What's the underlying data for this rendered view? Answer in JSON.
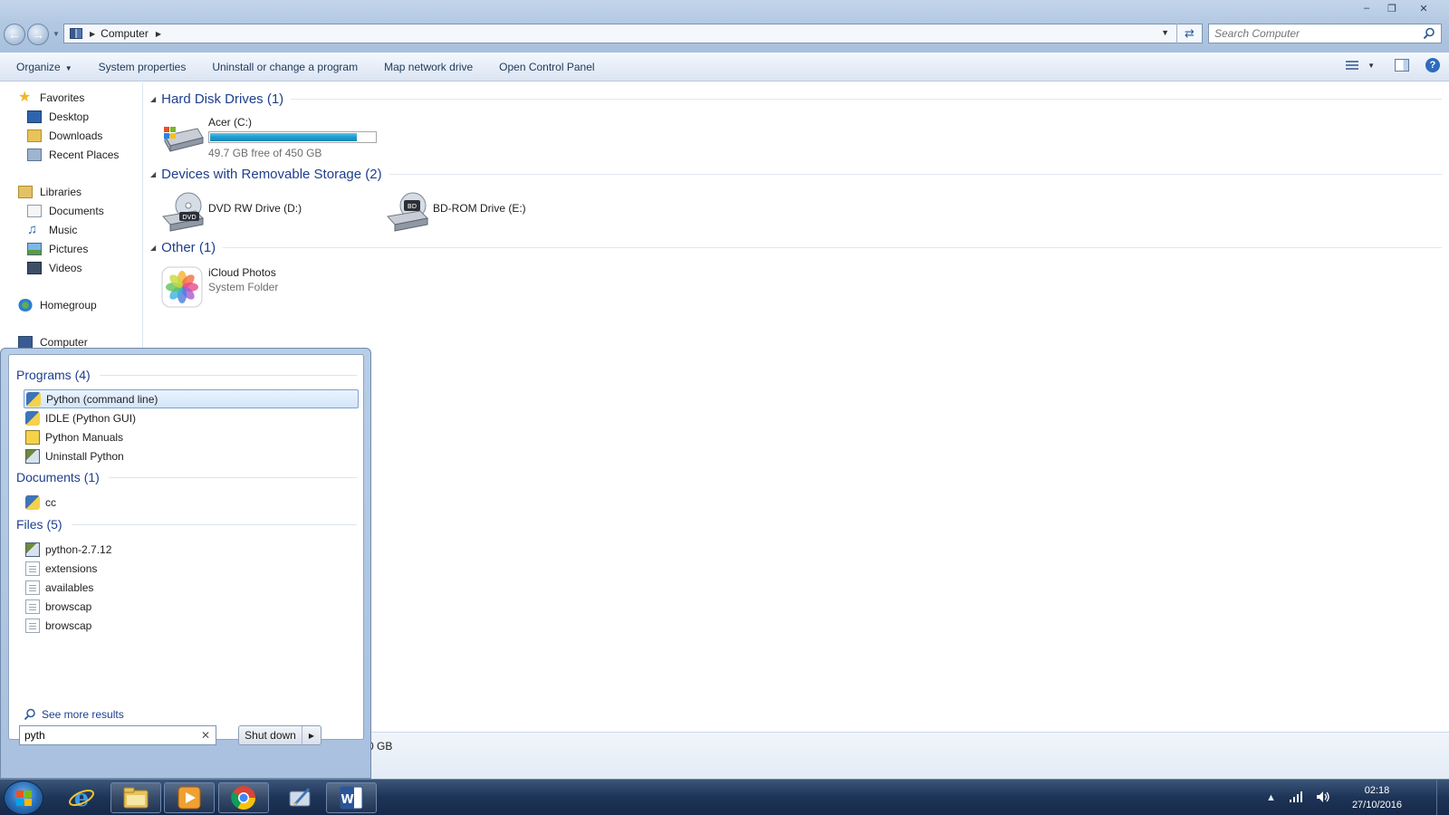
{
  "address": {
    "path": "Computer"
  },
  "search": {
    "placeholder": "Search Computer"
  },
  "commands": {
    "organize": "Organize",
    "system_properties": "System properties",
    "uninstall": "Uninstall or change a program",
    "map_drive": "Map network drive",
    "control_panel": "Open Control Panel"
  },
  "nav": {
    "favorites": "Favorites",
    "desktop": "Desktop",
    "downloads": "Downloads",
    "recent": "Recent Places",
    "libraries": "Libraries",
    "documents": "Documents",
    "music": "Music",
    "pictures": "Pictures",
    "videos": "Videos",
    "homegroup": "Homegroup",
    "computer": "Computer"
  },
  "groups": {
    "hdd": "Hard Disk Drives (1)",
    "removable": "Devices with Removable Storage (2)",
    "other": "Other (1)"
  },
  "drives": {
    "c": {
      "name": "Acer (C:)",
      "free": "49.7 GB free of 450 GB",
      "used_fraction": 0.89
    },
    "d": {
      "name": "DVD RW Drive (D:)"
    },
    "e": {
      "name": "BD-ROM Drive (E:)"
    }
  },
  "other": {
    "name": "iCloud Photos",
    "type": "System Folder"
  },
  "details": {
    "text": "0 GB"
  },
  "startmenu": {
    "programs_head": "Programs (4)",
    "programs": [
      "Python (command line)",
      "IDLE (Python GUI)",
      "Python Manuals",
      "Uninstall Python"
    ],
    "documents_head": "Documents (1)",
    "documents": [
      "cc"
    ],
    "files_head": "Files (5)",
    "files": [
      "python-2.7.12",
      "extensions",
      "availables",
      "browscap",
      "browscap"
    ],
    "see_more": "See more results",
    "search_value": "pyth",
    "shutdown": "Shut down"
  },
  "clock": {
    "time": "02:18",
    "date": "27/10/2016"
  },
  "colors": {
    "accent_blue": "#1e3f8c",
    "capacity_fill": "#1f9ed1",
    "taskbar": "#1d3456"
  }
}
